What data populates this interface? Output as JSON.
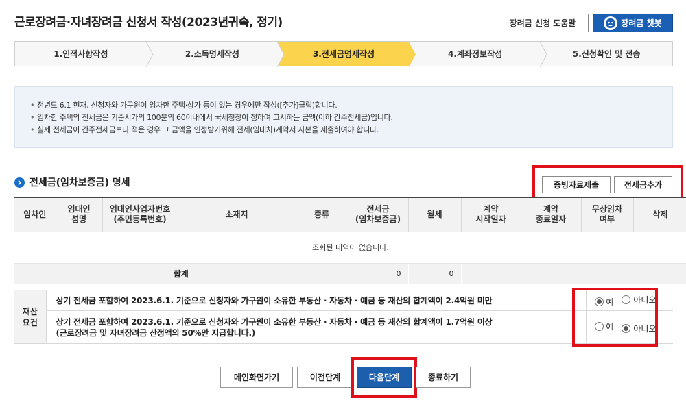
{
  "header": {
    "title": "근로장려금·자녀장려금 신청서 작성(2023년귀속, 정기)",
    "help_label": "장려금 신청 도움말",
    "chatbot_label": "장려금 챗봇"
  },
  "steps": [
    {
      "label": "1.인적사항작성",
      "active": false
    },
    {
      "label": "2.소득명세작성",
      "active": false
    },
    {
      "label": "3.전세금명세작성",
      "active": true
    },
    {
      "label": "4.계좌정보작성",
      "active": false
    },
    {
      "label": "5.신청확인 및 전송",
      "active": false
    }
  ],
  "notice": [
    "전년도 6.1 현재, 신청자와 가구원이 임차한 주택·상가 등이 있는 경우에만 작성([추가]클릭)합니다.",
    "임차한 주택의 전세금은 기준시가의 100분의 60이내에서 국세청장이 정하여 고시하는 금액(이하 간주전세금)입니다.",
    "실제 전세금이 간주전세금보다 적은 경우 그 금액을 인정받기위해 전세(임대차)계약서 사본을 제출하여야 합니다."
  ],
  "section": {
    "title": "전세금(임차보증금) 명세",
    "evidence_btn": "증빙자료제출",
    "add_btn": "전세금추가"
  },
  "table": {
    "columns": [
      [
        "임차인"
      ],
      [
        "임대인",
        "성명"
      ],
      [
        "임대인사업자번호",
        "(주민등록번호)"
      ],
      [
        "소재지"
      ],
      [
        "종류"
      ],
      [
        "전세금",
        "(임차보증금)"
      ],
      [
        "월세"
      ],
      [
        "계약",
        "시작일자"
      ],
      [
        "계약",
        "종료일자"
      ],
      [
        "무상임차",
        "여부"
      ],
      [
        "삭제"
      ]
    ],
    "empty_message": "조회된 내역이 없습니다.",
    "total_label": "합계",
    "total_deposit": "0",
    "total_rent": "0"
  },
  "asset": {
    "label_line1": "재산",
    "label_line2": "요건",
    "rows": [
      {
        "text_line1": "상기 전세금 포함하여 2023.6.1. 기준으로 신청자와 가구원이 소유한 부동산 · 자동차 · 예금 등 재산의 합계액이 2.4억원 미만",
        "text_line2": "",
        "yes_label": "예",
        "no_label": "아니오",
        "selected": "yes"
      },
      {
        "text_line1": "상기 전세금 포함하여 2023.6.1. 기준으로 신청자와 가구원이 소유한 부동산 · 자동차 · 예금 등 재산의 합계액이 1.7억원 이상",
        "text_line2": "(근로장려금 및 자녀장려금 산정액의 50%만 지급합니다.)",
        "yes_label": "예",
        "no_label": "아니오",
        "selected": "no"
      }
    ]
  },
  "buttons": {
    "main": "메인화면가기",
    "prev": "이전단계",
    "next": "다음단계",
    "finish": "종료하기"
  },
  "colors": {
    "active_step": "#fcd34d",
    "primary": "#1c5fad",
    "highlight": "#e0101a"
  }
}
